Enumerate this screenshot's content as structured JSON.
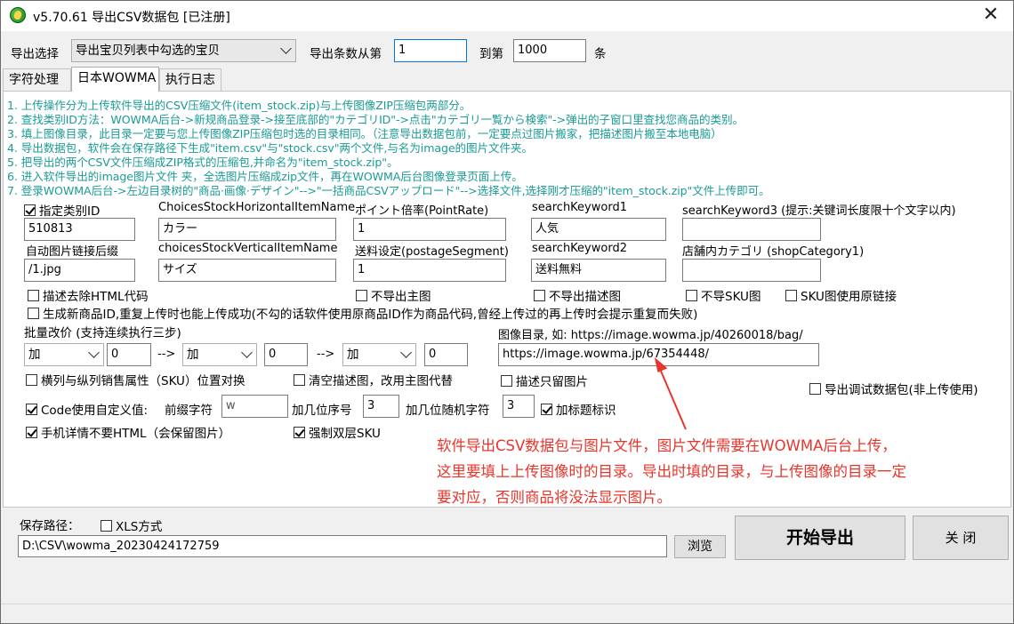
{
  "window": {
    "title": "v5.70.61  导出CSV数据包 [已注册]",
    "close_glyph": "✕"
  },
  "top": {
    "export_select_label": "导出选择",
    "export_select_value": "导出宝贝列表中勾选的宝贝",
    "count_from_label": "导出条数从第",
    "count_from_value": "1",
    "count_to_label": "到第",
    "count_to_value": "1000",
    "count_unit": "条"
  },
  "tabs": [
    {
      "label": "字符处理"
    },
    {
      "label": "日本WOWMA"
    },
    {
      "label": "执行日志"
    }
  ],
  "instructions": [
    "1. 上传操作分为上传软件导出的CSV压缩文件(item_stock.zip)与上传图像ZIP压缩包两部分。",
    "2. 查找类别ID方法：WOWMA后台->新规商品登录->接至底部的\"カテゴリID\"->点击\"カテゴリ一覧から検索\"->弹出的子窗口里查找您商品的类别。",
    "3. 填上图像目录，此目录一定要与您上传图像ZIP压缩包时选的目录相同。（注意导出数据包前，一定要点过图片搬家，把描述图片搬至本地电脑）",
    "4. 导出数据包，软件会在保存路径下生成\"item.csv\"与\"stock.csv\"两个文件,与名为image的图片文件夹。",
    "5. 把导出的两个CSV文件压缩成ZIP格式的压缩包,并命名为\"item_stock.zip\"。",
    "6. 进入软件导出的image图片文件 夹，全选图片压缩成zip文件，再在WOWMA后台图像登录页面上传。",
    "7. 登录WOWMA后台->左边目录树的\"商品·画像·デザイン\"-->\"一括商品CSVアップロード\"-->选择文件,选择刚才压缩的\"item_stock.zip\"文件上传即可。"
  ],
  "fields": {
    "category_id": {
      "label": "指定类别ID",
      "value": "510813",
      "checked": true
    },
    "horizontal_item": {
      "label": "ChoicesStockHorizontalItemName",
      "value": "カラー"
    },
    "point_rate": {
      "label": "ポイント倍率(PointRate)",
      "value": "1"
    },
    "search_keyword1": {
      "label": "searchKeyword1",
      "value": "人気"
    },
    "search_keyword3": {
      "label": "searchKeyword3 (提示:关键词长度限十个文字以内)",
      "value": ""
    },
    "image_suffix": {
      "label": "自动图片链接后缀",
      "value": "/1.jpg"
    },
    "vertical_item": {
      "label": "choicesStockVerticalItemName",
      "value": "サイズ"
    },
    "postage_segment": {
      "label": "送料设定(postageSegment)",
      "value": "1"
    },
    "search_keyword2": {
      "label": "searchKeyword2",
      "value": "送料無料"
    },
    "shop_category": {
      "label": "店舗内カテゴリ (shopCategory1)",
      "value": ""
    }
  },
  "options": {
    "strip_html": {
      "label": "描述去除HTML代码",
      "checked": false
    },
    "no_main_image": {
      "label": "不导出主图",
      "checked": false
    },
    "no_desc_image": {
      "label": "不导出描述图",
      "checked": false
    },
    "no_sku_image": {
      "label": "不导SKU图",
      "checked": false
    },
    "sku_original_link": {
      "label": "SKU图使用原链接",
      "checked": false
    },
    "new_item_id": {
      "label": "生成新商品ID,重复上传时也能上传成功(不勾的话软件使用原商品ID作为商品代码,曾经上传过的再上传时会提示重复而失败)",
      "checked": false
    }
  },
  "batch_price": {
    "label": "批量改价 (支持连续执行三步)",
    "ops": [
      "加",
      "加",
      "加"
    ],
    "values": [
      "0",
      "0",
      "0"
    ],
    "arrow": "-->"
  },
  "image_dir": {
    "label": "图像目录, 如: https://image.wowma.jp/40260018/bag/",
    "value": "https://image.wowma.jp/67354448/"
  },
  "more_options": {
    "swap_sku": {
      "label": "横列与纵列销售属性（SKU）位置对换",
      "checked": false
    },
    "clear_desc": {
      "label": "清空描述图，改用主图代替",
      "checked": false
    },
    "desc_only_image": {
      "label": "描述只留图片",
      "checked": false
    },
    "debug_package": {
      "label": "导出调试数据包(非上传使用)",
      "checked": false
    },
    "code_custom": {
      "label": "Code使用自定义值:",
      "checked": true
    },
    "prefix_label": "前缀字符",
    "prefix_value": "w",
    "seq_digits_label": "加几位序号",
    "seq_digits_value": "3",
    "rand_digits_label": "加几位随机字符",
    "rand_digits_value": "3",
    "title_mark": {
      "label": "加标题标识",
      "checked": true
    },
    "mobile_no_html": {
      "label": "手机详情不要HTML（会保留图片）",
      "checked": true
    },
    "force_double_sku": {
      "label": "强制双层SKU",
      "checked": true
    }
  },
  "annotation": {
    "lines": [
      "软件导出CSV数据包与图片文件，图片文件需要在WOWMA后台上传，",
      "这里要填上上传图像时的目录。导出时填的目录，与上传图像的目录一定",
      "要对应，否则商品将没法显示图片。"
    ],
    "color": "#e8342a"
  },
  "save": {
    "label": "保存路径：",
    "xls_label": "XLS方式",
    "xls_checked": false,
    "path": "D:\\CSV\\wowma_20230424172759",
    "browse_label": "浏览",
    "start_label": "开始导出",
    "close_label": "关 闭"
  }
}
